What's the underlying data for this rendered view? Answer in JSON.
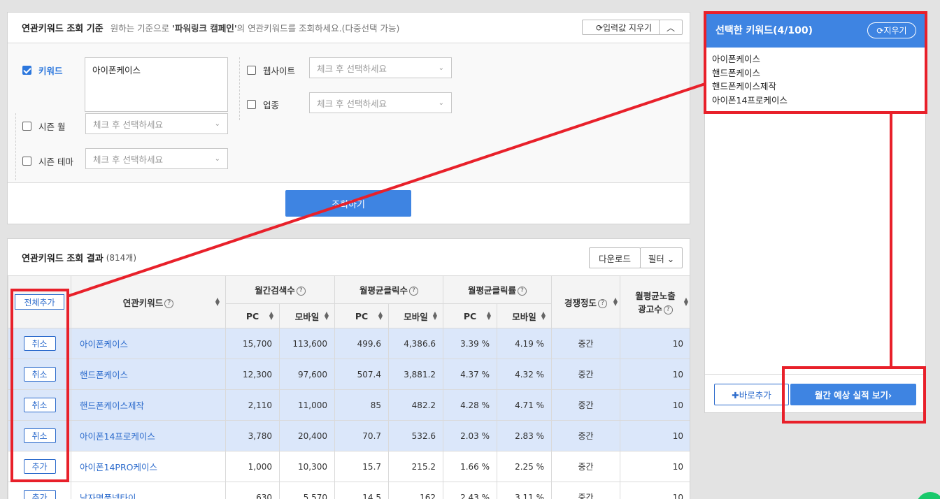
{
  "criteria": {
    "title": "연관키워드 조회 기준",
    "desc_prefix": "원하는 기준으로 ",
    "desc_bold": "'파워링크 캠페인'",
    "desc_suffix": "의 연관키워드를 조회하세요.(다중선택 가능)",
    "reset_input_label": "⟳입력값 지우기",
    "collapse_label": "︿",
    "keyword_label": "키워드",
    "keyword_value": "아이폰케이스",
    "website_label": "웹사이트",
    "industry_label": "업종",
    "season_month_label": "시즌 월",
    "season_theme_label": "시즌 테마",
    "select_placeholder": "체크 후 선택하세요",
    "search_button": "조회하기"
  },
  "results": {
    "title": "연관키워드 조회 결과",
    "count": "(814개)",
    "download_label": "다운로드",
    "filter_label": "필터 ⌄",
    "add_all_label": "전체추가",
    "headers": {
      "keyword": "연관키워드",
      "monthly_search": "월간검색수",
      "avg_clicks": "월평균클릭수",
      "avg_ctr": "월평균클릭률",
      "competition": "경쟁정도",
      "avg_ads_line1": "월평균노출",
      "avg_ads_line2": "광고수",
      "pc": "PC",
      "mobile": "모바일"
    },
    "rows": [
      {
        "action": "취소",
        "selected": true,
        "keyword": "아이폰케이스",
        "search_pc": "15,700",
        "search_mobile": "113,600",
        "click_pc": "499.6",
        "click_mobile": "4,386.6",
        "ctr_pc": "3.39 %",
        "ctr_mobile": "4.19 %",
        "competition": "중간",
        "ads": "10"
      },
      {
        "action": "취소",
        "selected": true,
        "keyword": "핸드폰케이스",
        "search_pc": "12,300",
        "search_mobile": "97,600",
        "click_pc": "507.4",
        "click_mobile": "3,881.2",
        "ctr_pc": "4.37 %",
        "ctr_mobile": "4.32 %",
        "competition": "중간",
        "ads": "10"
      },
      {
        "action": "취소",
        "selected": true,
        "keyword": "핸드폰케이스제작",
        "search_pc": "2,110",
        "search_mobile": "11,000",
        "click_pc": "85",
        "click_mobile": "482.2",
        "ctr_pc": "4.28 %",
        "ctr_mobile": "4.71 %",
        "competition": "중간",
        "ads": "10"
      },
      {
        "action": "취소",
        "selected": true,
        "keyword": "아이폰14프로케이스",
        "search_pc": "3,780",
        "search_mobile": "20,400",
        "click_pc": "70.7",
        "click_mobile": "532.6",
        "ctr_pc": "2.03 %",
        "ctr_mobile": "2.83 %",
        "competition": "중간",
        "ads": "10"
      },
      {
        "action": "추가",
        "selected": false,
        "keyword": "아이폰14PRO케이스",
        "search_pc": "1,000",
        "search_mobile": "10,300",
        "click_pc": "15.7",
        "click_mobile": "215.2",
        "ctr_pc": "1.66 %",
        "ctr_mobile": "2.25 %",
        "competition": "중간",
        "ads": "10"
      },
      {
        "action": "추가",
        "selected": false,
        "keyword": "남자명품넥타이",
        "search_pc": "630",
        "search_mobile": "5,570",
        "click_pc": "14.5",
        "click_mobile": "162",
        "ctr_pc": "2.43 %",
        "ctr_mobile": "3.11 %",
        "competition": "중간",
        "ads": "10"
      }
    ]
  },
  "selected_panel": {
    "title": "선택한 키워드(4/100)",
    "clear_label": "⟳지우기",
    "keywords": [
      "아이폰케이스",
      "핸드폰케이스",
      "핸드폰케이스제작",
      "아이폰14프로케이스"
    ],
    "quick_add_label": "✚바로추가",
    "forecast_label": "월간 예상 실적 보기›"
  },
  "colors": {
    "accent": "#3e84e2",
    "selected_row": "#dbe7fa",
    "annotation_red": "#e8202a"
  }
}
